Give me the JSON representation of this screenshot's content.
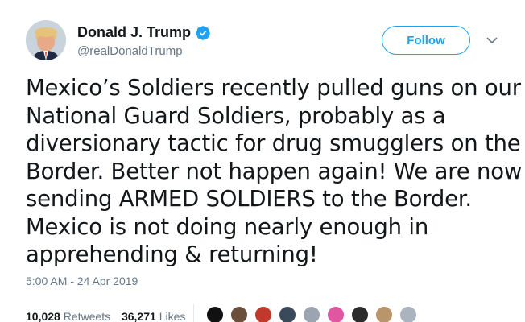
{
  "tweet": {
    "author": {
      "display_name": "Donald J. Trump",
      "handle": "@realDonaldTrump",
      "verified_icon": "verified-badge-icon",
      "avatar_icon": "avatar"
    },
    "follow_label": "Follow",
    "more_icon": "chevron-down-icon",
    "text_lines": [
      "Mexico’s Soldiers recently pulled guns on our",
      "National Guard Soldiers, probably as a",
      "diversionary tactic for drug smugglers on the",
      "Border. Better not happen again! We are now",
      "sending ARMED SOLDIERS to the Border.",
      "Mexico is not doing nearly enough in",
      "apprehending & returning!"
    ],
    "timestamp": "5:00 AM - 24 Apr 2019",
    "stats": {
      "retweets_count": "10,028",
      "retweets_label": "Retweets",
      "likes_count": "36,271",
      "likes_label": "Likes"
    }
  },
  "colors": {
    "accent": "#1da1f2",
    "text": "#14171a",
    "muted": "#657786"
  }
}
